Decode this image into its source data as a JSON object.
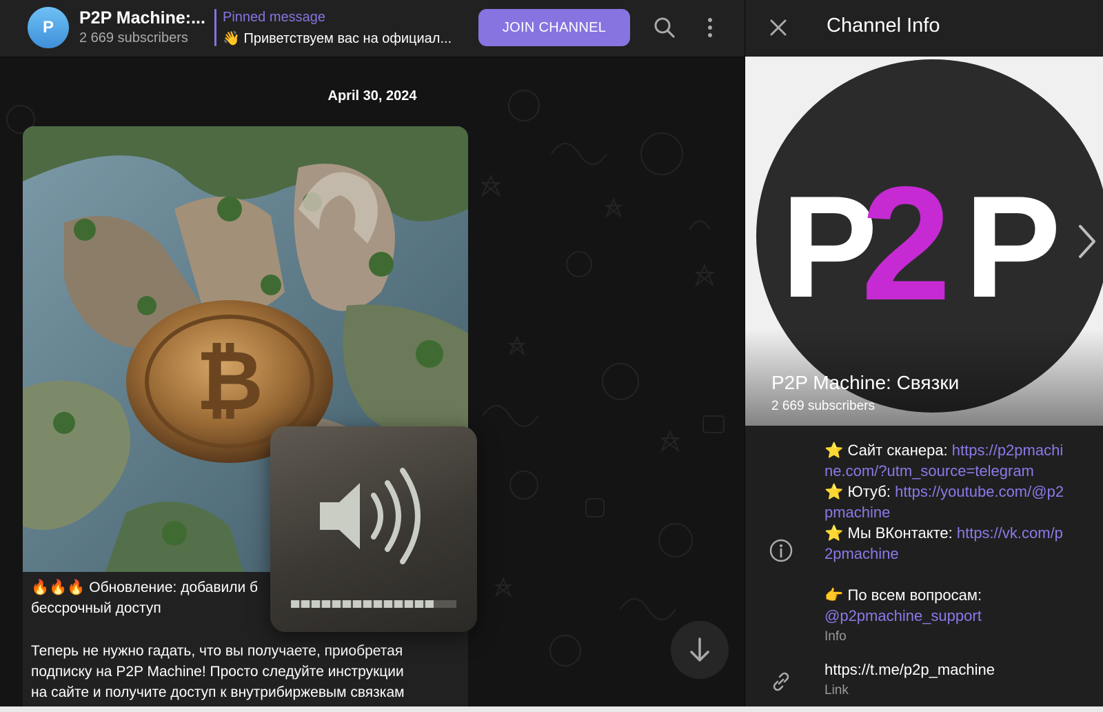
{
  "chat_header": {
    "avatar_letter": "P",
    "title": "P2P Machine:...",
    "subscribers": "2 669 subscribers",
    "pinned_label": "Pinned message",
    "pinned_text": "👋 Приветствуем вас на официал...",
    "join_label": "JOIN CHANNEL"
  },
  "chat": {
    "date": "April 30, 2024",
    "message": {
      "heading_line1": "🔥🔥🔥 Обновление: добавили б",
      "heading_line2": "бессрочный доступ",
      "body_line1": "Теперь не нужно гадать, что вы получаете, приобретая",
      "body_line2": "подписку на P2P Machine! Просто следуйте инструкции",
      "body_line3": "на сайте и получите доступ к внутрибиржевым связкам",
      "volume_level": 0.85
    }
  },
  "info_panel": {
    "title": "Channel Info",
    "cover_name": "P2P Machine: Связки",
    "cover_subscribers": "2 669 subscribers",
    "logo_p1": "P",
    "logo_2": "2",
    "logo_p2": "P",
    "description": {
      "line1_label": "⭐ Сайт сканера: ",
      "line1_link_a": "https://p2pmachi",
      "line1_link_b": "ne.com/?utm_source=telegram",
      "line2_label": "⭐ Ютуб: ",
      "line2_link_a": "https://youtube.com/@p2",
      "line2_link_b": "pmachine",
      "line3_label": "⭐ Мы ВКонтакте: ",
      "line3_link_a": "https://vk.com/p",
      "line3_link_b": "2pmachine",
      "line4_label": "👉 По всем вопросам:",
      "line4_link": "@p2pmachine_support",
      "caption": "Info"
    },
    "link": {
      "value": "https://t.me/p2p_machine",
      "caption": "Link"
    }
  },
  "colors": {
    "accent": "#8774e1",
    "link": "#8b7ae8",
    "logo_magenta": "#c62ad3"
  },
  "icons": [
    "search-icon",
    "more-vertical-icon",
    "close-icon",
    "info-icon",
    "link-icon",
    "arrow-down-icon",
    "speaker-icon",
    "chevron-right-icon"
  ]
}
